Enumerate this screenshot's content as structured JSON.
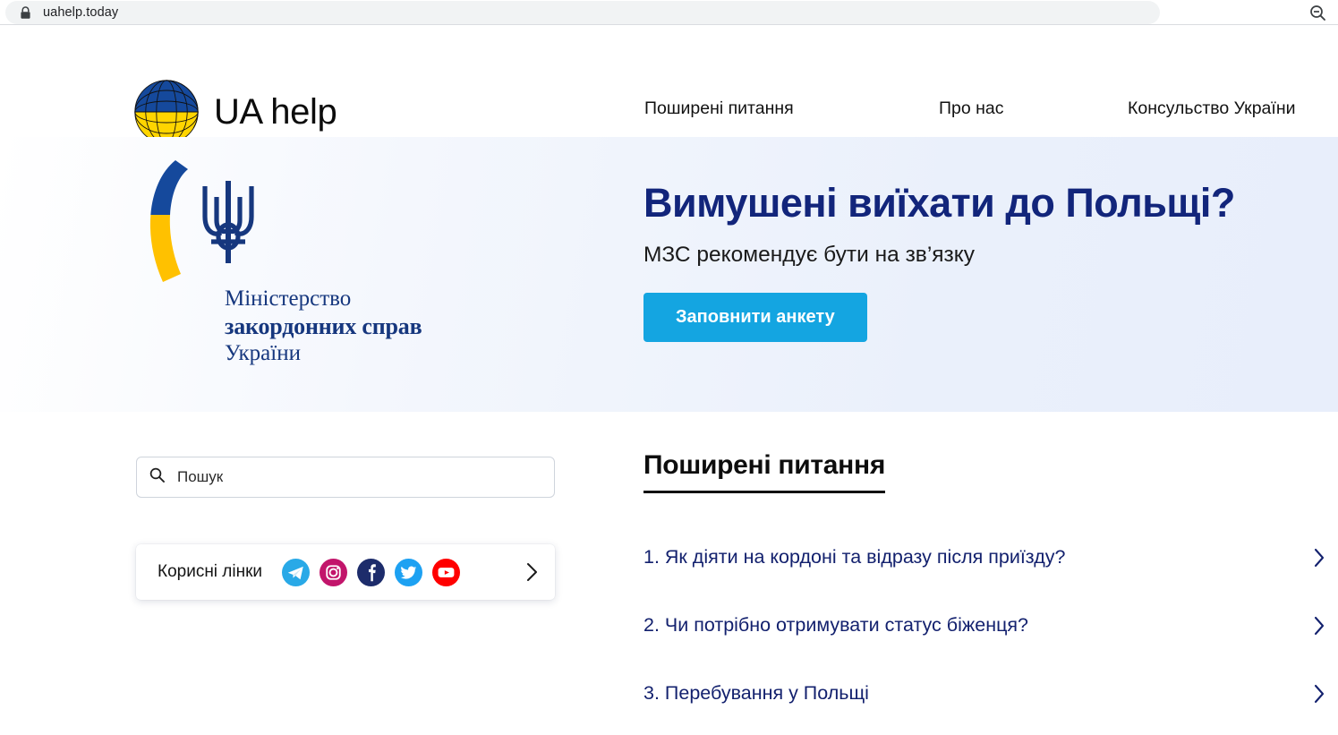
{
  "browser": {
    "url": "uahelp.today",
    "lock_icon": "lock-icon",
    "zoom_out_icon": "magnifier-minus-icon"
  },
  "header": {
    "brand_name": "UA help",
    "logo_icon": "globe-ua-logo",
    "nav": [
      {
        "label": "Поширені питання"
      },
      {
        "label": "Про нас"
      },
      {
        "label": "Консульство України"
      }
    ]
  },
  "hero": {
    "ministry": {
      "arc_icon": "ua-crescent-arc",
      "emblem_icon": "tryzub-trident-icon",
      "line1": "Міністерство",
      "line2": "закордонних справ",
      "line3": "України"
    },
    "title": "Вимушені виїхати до Польщі?",
    "subtitle": "МЗС рекомендує бути на зв’язку",
    "cta_label": "Заповнити анкету"
  },
  "search": {
    "icon": "search-icon",
    "placeholder": "Пошук",
    "value": ""
  },
  "useful_links": {
    "label": "Корисні лінки",
    "chevron_icon": "chevron-right-icon",
    "socials": [
      {
        "name": "telegram-icon",
        "color": "#2AABEE"
      },
      {
        "name": "instagram-icon",
        "color": "#C2156B"
      },
      {
        "name": "facebook-icon",
        "color": "#1D2C6B"
      },
      {
        "name": "twitter-icon",
        "color": "#1DA1F2"
      },
      {
        "name": "youtube-icon",
        "color": "#FF0000"
      }
    ]
  },
  "faq": {
    "heading": "Поширені питання",
    "items": [
      {
        "label": "1. Як діяти на кордоні та відразу після приїзду?",
        "chevron": "chevron-right-icon"
      },
      {
        "label": "2. Чи потрібно отримувати статус біженця?",
        "chevron": "chevron-right-icon"
      },
      {
        "label": "3. Перебування у Польщі",
        "chevron": "chevron-right-icon"
      }
    ]
  },
  "colors": {
    "brand_navy": "#12257b",
    "cta_blue": "#14a5e1",
    "ministry_blue": "#16377e",
    "ua_yellow": "#ffc800"
  }
}
